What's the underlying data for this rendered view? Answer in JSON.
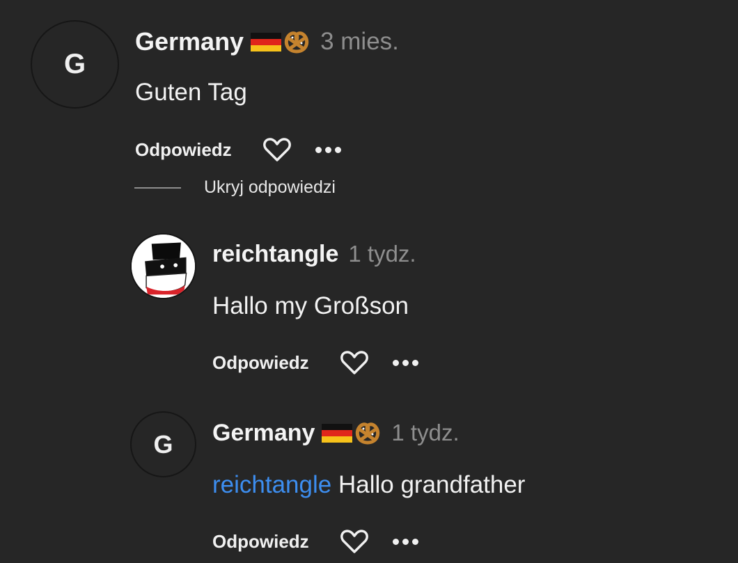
{
  "comments": [
    {
      "avatar_letter": "G",
      "username": "Germany",
      "badges": [
        "german-flag",
        "pretzel"
      ],
      "time": "3 mies.",
      "text": "Guten Tag",
      "reply_label": "Odpowiedz"
    },
    {
      "avatar": "flag-ball-avatar",
      "username": "reichtangle",
      "time": "1 tydz.",
      "text": "Hallo my Großson",
      "reply_label": "Odpowiedz"
    },
    {
      "avatar_letter": "G",
      "username": "Germany",
      "badges": [
        "german-flag",
        "pretzel"
      ],
      "time": "1 tydz.",
      "mention": "reichtangle",
      "text": "Hallo grandfather",
      "reply_label": "Odpowiedz"
    }
  ],
  "hide_replies_label": "Ukryj odpowiedzi",
  "colors": {
    "background": "#262626",
    "mention": "#3d8ef0",
    "muted": "#8e8e8e"
  }
}
